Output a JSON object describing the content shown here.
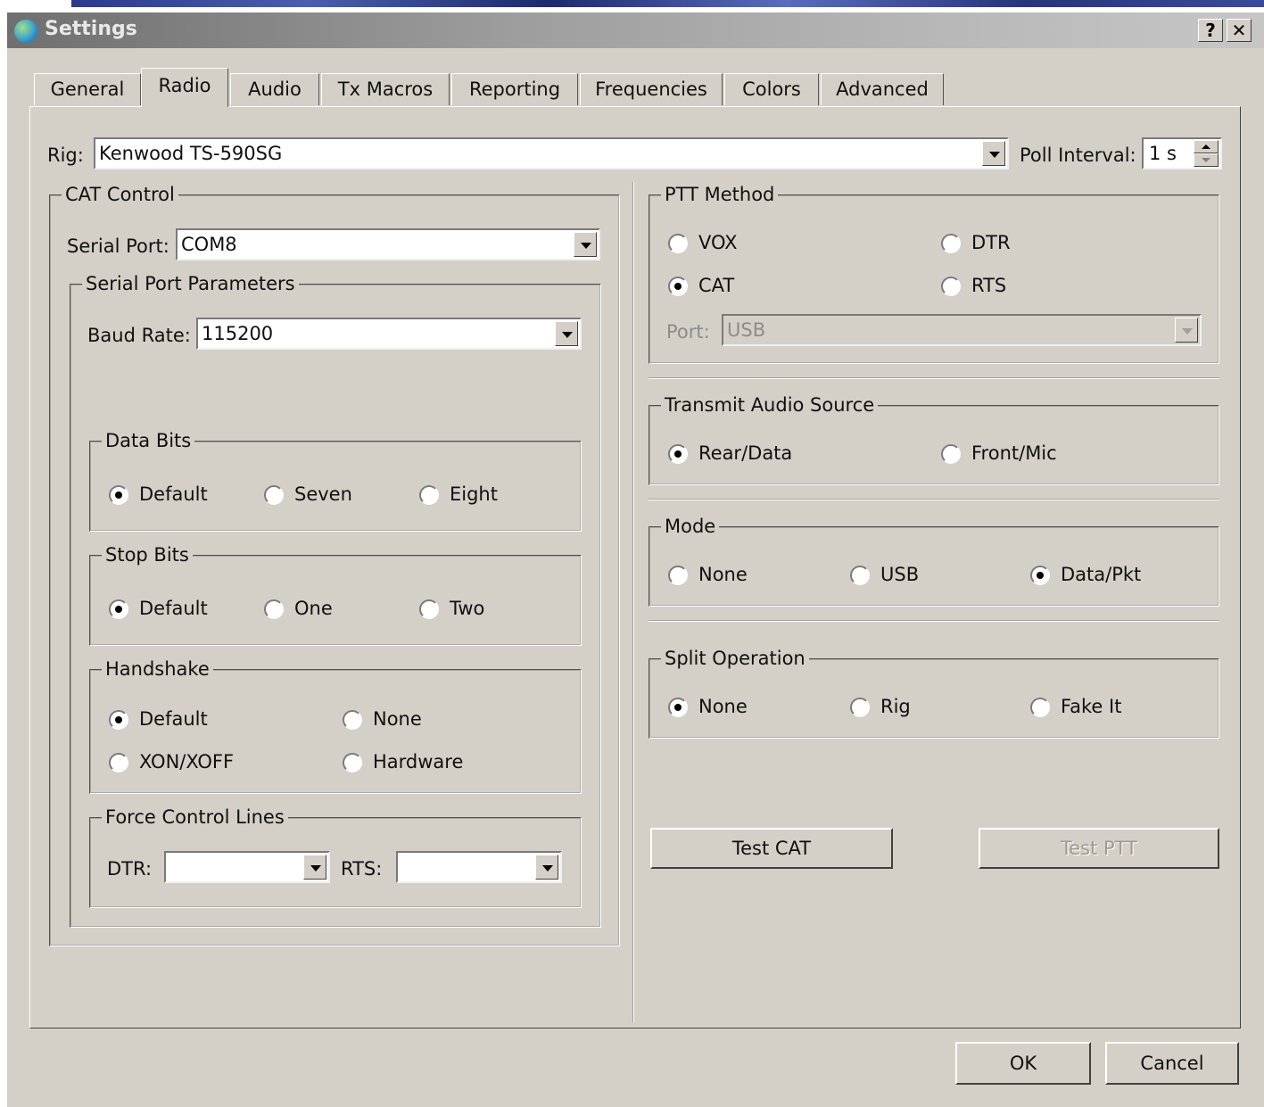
{
  "window": {
    "title": "Settings",
    "help_btn": "?",
    "close_btn": "✕"
  },
  "tabs": [
    {
      "label": "General"
    },
    {
      "label": "Radio",
      "active": true
    },
    {
      "label": "Audio"
    },
    {
      "label": "Tx Macros"
    },
    {
      "label": "Reporting"
    },
    {
      "label": "Frequencies"
    },
    {
      "label": "Colors"
    },
    {
      "label": "Advanced"
    }
  ],
  "rig": {
    "label": "Rig:",
    "value": "Kenwood TS-590SG",
    "poll_label": "Poll Interval:",
    "poll_value": "1 s"
  },
  "cat": {
    "title": "CAT Control",
    "serial_label": "Serial Port:",
    "serial_value": "COM8",
    "params_title": "Serial Port Parameters",
    "baud_label": "Baud Rate:",
    "baud_value": "115200",
    "data_bits": {
      "title": "Data Bits",
      "options": [
        "Default",
        "Seven",
        "Eight"
      ],
      "selected": "Default"
    },
    "stop_bits": {
      "title": "Stop Bits",
      "options": [
        "Default",
        "One",
        "Two"
      ],
      "selected": "Default"
    },
    "handshake": {
      "title": "Handshake",
      "options": [
        "Default",
        "None",
        "XON/XOFF",
        "Hardware"
      ],
      "selected": "Default"
    },
    "force": {
      "title": "Force Control Lines",
      "dtr_label": "DTR:",
      "dtr_value": "",
      "rts_label": "RTS:",
      "rts_value": ""
    }
  },
  "ptt": {
    "title": "PTT Method",
    "options": [
      "VOX",
      "DTR",
      "CAT",
      "RTS"
    ],
    "selected": "CAT",
    "port_label": "Port:",
    "port_value": "USB"
  },
  "audio_src": {
    "title": "Transmit Audio Source",
    "options": [
      "Rear/Data",
      "Front/Mic"
    ],
    "selected": "Rear/Data"
  },
  "mode": {
    "title": "Mode",
    "options": [
      "None",
      "USB",
      "Data/Pkt"
    ],
    "selected": "Data/Pkt"
  },
  "split": {
    "title": "Split Operation",
    "options": [
      "None",
      "Rig",
      "Fake It"
    ],
    "selected": "None"
  },
  "buttons": {
    "test_cat": "Test CAT",
    "test_ptt": "Test PTT",
    "ok": "OK",
    "cancel": "Cancel"
  }
}
